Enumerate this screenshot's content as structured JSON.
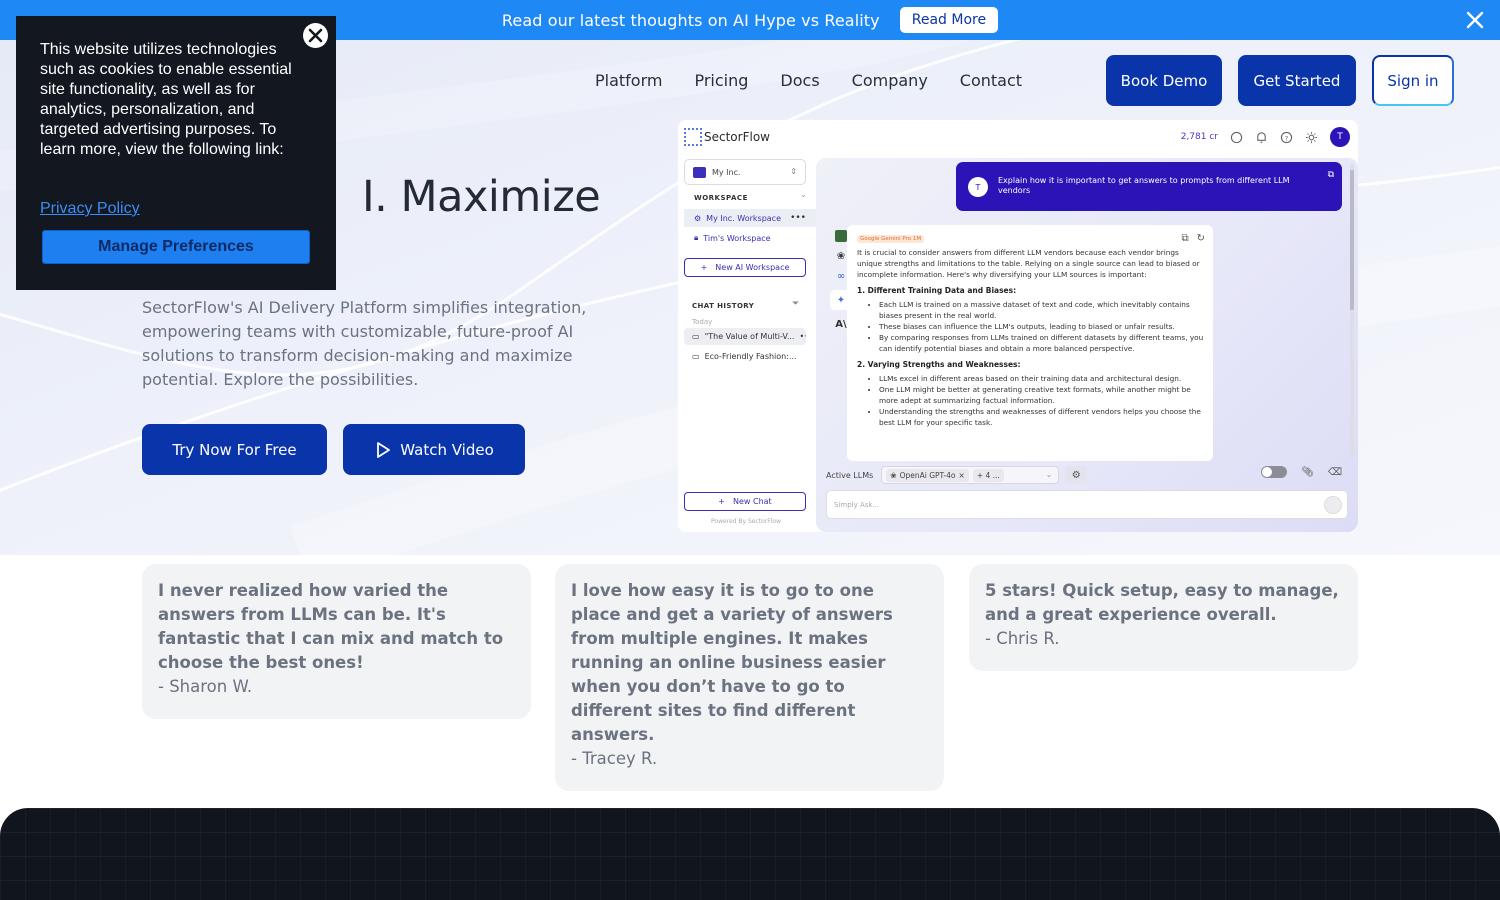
{
  "announcement": {
    "text": "Read our latest thoughts on AI Hype vs Reality",
    "button": "Read More",
    "close_icon": "close-icon"
  },
  "nav": {
    "links": [
      "Platform",
      "Pricing",
      "Docs",
      "Company",
      "Contact"
    ],
    "book_demo": "Book Demo",
    "get_started": "Get Started",
    "sign_in": "Sign in"
  },
  "hero": {
    "title_line1_visible": "I. Maximize",
    "title_line2_visible": "",
    "description": "SectorFlow's AI Delivery Platform simplifies integration, empowering teams with customizable, future-proof AI solutions to transform decision-making and maximize potential. Explore the possibilities.",
    "cta_primary": "Try Now For Free",
    "cta_secondary": "Watch Video",
    "cta_secondary_icon": "play-icon"
  },
  "app_preview": {
    "logo": "SectorFlow",
    "credits": "2,781 cr",
    "avatar_initial": "T",
    "org": "My Inc.",
    "workspace_label": "WORKSPACE",
    "workspaces": [
      "My Inc. Workspace",
      "Tim's Workspace"
    ],
    "new_workspace": "New AI Workspace",
    "chat_history_label": "CHAT HISTORY",
    "today_label": "Today",
    "chats": [
      "\"The Value of Multi-V...",
      "Eco-Friendly Fashion:..."
    ],
    "new_chat": "New Chat",
    "powered_by": "Powered By SectorFlow",
    "prompt": "Explain how it is important to get answers to prompts from different LLM vendors",
    "prompt_avatar": "T",
    "answer_model_tag": "Google Gemini Pro 1M",
    "answer_intro": "It is crucial to consider answers from different LLM vendors because each vendor brings unique strengths and limitations to the table. Relying on a single source can lead to biased or incomplete information. Here's why diversifying your LLM sources is important:",
    "sections": [
      {
        "heading": "1. Different Training Data and Biases:",
        "bullets": [
          "Each LLM is trained on a massive dataset of text and code, which inevitably contains biases present in the real world.",
          "These biases can influence the LLM's outputs, leading to biased or unfair results.",
          "By comparing responses from LLMs trained on different datasets by different teams, you can identify potential biases and obtain a more balanced perspective."
        ]
      },
      {
        "heading": "2. Varying Strengths and Weaknesses:",
        "bullets": [
          "LLMs excel in different areas based on their training data and architectural design.",
          "One LLM might be better at generating creative text formats, while another might be more adept at summarizing factual information.",
          "Understanding the strengths and weaknesses of different vendors helps you choose the best LLM for your specific task."
        ]
      }
    ],
    "active_llms_label": "Active LLMs",
    "active_llm_chip": "OpenAi GPT-4o",
    "more_llms": "+ 4 ...",
    "ask_placeholder": "Simply Ask..."
  },
  "testimonials": [
    {
      "quote": "I never realized how varied the answers from LLMs can be. It's fantastic that I can mix and match to choose the best ones!",
      "author": "- Sharon W."
    },
    {
      "quote": "I love how easy it is to go to one place and get a variety of answers from multiple engines. It makes running an online business easier when you don’t have to go to different sites to find different answers.",
      "author": "- Tracey R."
    },
    {
      "quote": "5 stars! Quick setup, easy to manage, and a great experience overall.",
      "author": "- Chris R."
    }
  ],
  "cookie": {
    "text": "This website utilizes technologies such as cookies to enable essential site functionality, as well as for analytics, personalization, and targeted advertising purposes. To learn more, view the following link:",
    "privacy_link": "Privacy Policy",
    "manage_button": "Manage Preferences"
  },
  "colors": {
    "brand_blue": "#0a35aa",
    "announce_blue": "#1e88f5",
    "app_purple": "#2b13b8",
    "dark_section": "#11151d"
  }
}
